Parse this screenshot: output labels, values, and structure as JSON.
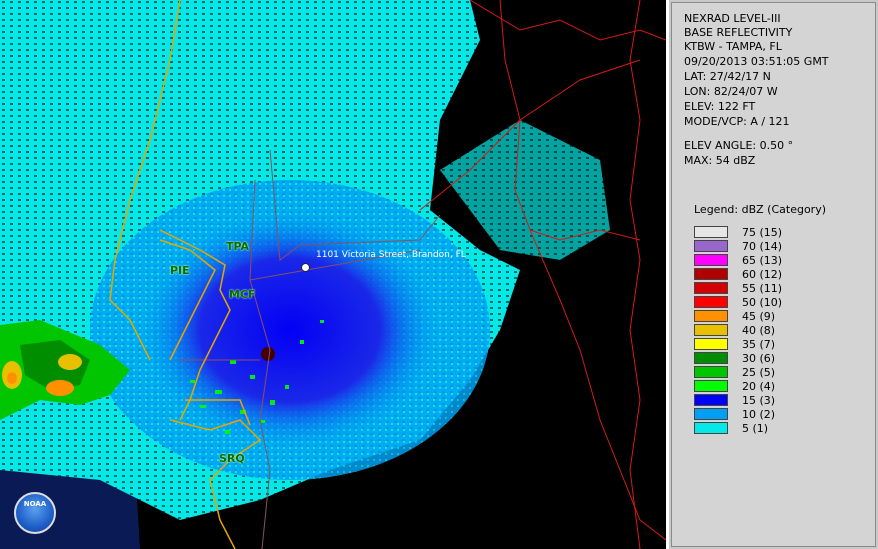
{
  "info": {
    "line1": "NEXRAD LEVEL-III",
    "line2": "BASE REFLECTIVITY",
    "station": "KTBW - TAMPA, FL",
    "datetime": "09/20/2013 03:51:05 GMT",
    "lat": "LAT: 27/42/17 N",
    "lon": "LON: 82/24/07 W",
    "elev": "ELEV: 122 FT",
    "mode": "MODE/VCP: A / 121",
    "elev_angle": "ELEV ANGLE: 0.50 °",
    "max": "MAX: 54 dBZ"
  },
  "legend": {
    "title": "Legend: dBZ (Category)",
    "items": [
      {
        "label": "75  (15)",
        "color": "#e6e6e6"
      },
      {
        "label": "70  (14)",
        "color": "#9966cc"
      },
      {
        "label": "65  (13)",
        "color": "#ff00ff"
      },
      {
        "label": "60  (12)",
        "color": "#b00000"
      },
      {
        "label": "55  (11)",
        "color": "#d40000"
      },
      {
        "label": "50  (10)",
        "color": "#ff0000"
      },
      {
        "label": "45  (9)",
        "color": "#ff9000"
      },
      {
        "label": "40  (8)",
        "color": "#e7c000"
      },
      {
        "label": "35  (7)",
        "color": "#ffff00"
      },
      {
        "label": "30  (6)",
        "color": "#008e00"
      },
      {
        "label": "25  (5)",
        "color": "#01c501"
      },
      {
        "label": "20  (4)",
        "color": "#02fd02"
      },
      {
        "label": "15  (3)",
        "color": "#0300f4"
      },
      {
        "label": "10  (2)",
        "color": "#019ff4"
      },
      {
        "label": "5  (1)",
        "color": "#04e9e7"
      }
    ]
  },
  "map": {
    "stations": [
      "TPA",
      "PIE",
      "MCF",
      "SRQ"
    ],
    "marker_label": "1101 Victoria Street, Brandon, FL",
    "logo_text": "NOAA"
  }
}
